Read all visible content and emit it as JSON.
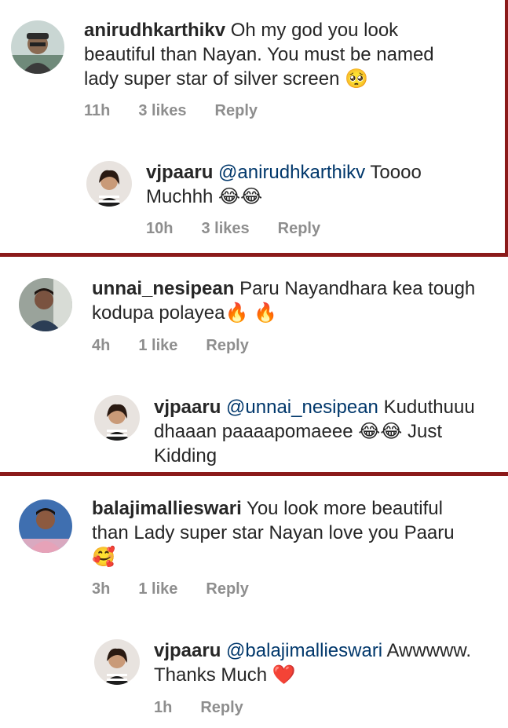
{
  "comments": [
    {
      "username": "anirudhkarthikv",
      "text_lines": [
        "Oh my god you look",
        "beautiful than Nayan. You must be named",
        "lady super star of silver screen 🥺"
      ],
      "time": "11h",
      "likes": "3 likes",
      "reply": "Reply",
      "reply_item": {
        "username": "vjpaaru",
        "mention": "@anirudhkarthikv",
        "text_first": "Toooo",
        "text_lines": [
          "Muchhh 😂😂"
        ],
        "time": "10h",
        "likes": "3 likes",
        "reply": "Reply"
      }
    },
    {
      "username": "unnai_nesipean",
      "text_lines": [
        "Paru Nayandhara kea tough",
        "kodupa polayea🔥 🔥"
      ],
      "time": "4h",
      "likes": "1 like",
      "reply": "Reply",
      "reply_item": {
        "username": "vjpaaru",
        "mention": "@unnai_nesipean",
        "text_first": "Kuduthuuu",
        "text_lines": [
          "dhaaan paaaapomaeee 😂😂 Just",
          "Kidding"
        ]
      }
    },
    {
      "username": "balajimallieswari",
      "text_lines": [
        "You look more beautiful",
        "than Lady super star Nayan love you  Paaru",
        "🥰"
      ],
      "time": "3h",
      "likes": "1 like",
      "reply": "Reply",
      "reply_item": {
        "username": "vjpaaru",
        "mention": "@balajimallieswari",
        "text_first": "Awwwww.",
        "text_lines": [
          "Thanks Much ❤️"
        ],
        "time": "1h",
        "reply": "Reply"
      }
    }
  ],
  "colors": {
    "divider": "#8b1a1a",
    "mention": "#00376b",
    "meta": "#8e8e8e"
  }
}
